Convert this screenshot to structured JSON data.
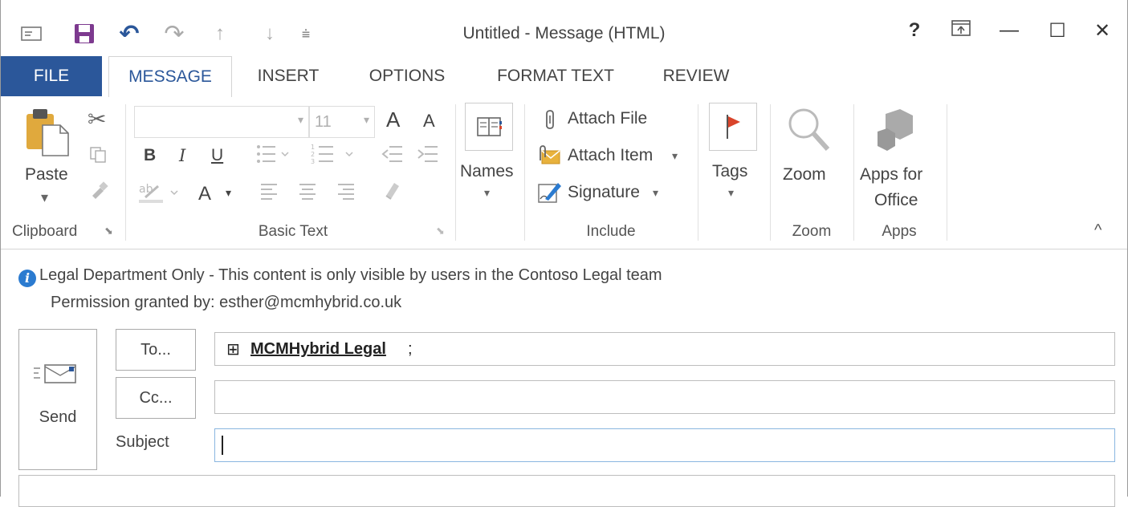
{
  "window": {
    "title": "Untitled - Message (HTML)",
    "help": "?",
    "restore_glyph": "⊼",
    "minimize": "—",
    "maximize": "☐",
    "close": "✕"
  },
  "quick_access": {
    "undo": "↶",
    "redo": "↷",
    "up": "↑",
    "down": "↓",
    "customize": "⩧"
  },
  "tabs": [
    "FILE",
    "MESSAGE",
    "INSERT",
    "OPTIONS",
    "FORMAT TEXT",
    "REVIEW"
  ],
  "ribbon": {
    "clipboard": {
      "paste": "Paste",
      "label": "Clipboard",
      "cut": "✂"
    },
    "basic_text": {
      "font_size": "11",
      "grow": "A",
      "shrink": "A",
      "bold": "B",
      "italic": "I",
      "underline": "U",
      "font_color": "A",
      "label": "Basic Text"
    },
    "names": {
      "label": "Names"
    },
    "include": {
      "attach_file": "Attach File",
      "attach_item": "Attach Item",
      "signature": "Signature",
      "label": "Include"
    },
    "tags": {
      "label": "Tags"
    },
    "zoom": {
      "button": "Zoom",
      "label": "Zoom"
    },
    "apps": {
      "button_line1": "Apps for",
      "button_line2": "Office",
      "label": "Apps"
    },
    "collapse": "^"
  },
  "info_bar": {
    "line1": "Legal Department Only - This content is only visible by users in the Contoso Legal team",
    "line2": "Permission granted by: esther@mcmhybrid.co.uk"
  },
  "form": {
    "send": "Send",
    "to_button": "To...",
    "cc_button": "Cc...",
    "subject_label": "Subject",
    "to_value": "MCMHybrid Legal",
    "to_suffix": ";",
    "expand": "⊞",
    "cc_value": "",
    "subject_value": ""
  },
  "colors": {
    "accent": "#2b579a",
    "flag": "#d9442b",
    "info": "#2b7bd0"
  }
}
